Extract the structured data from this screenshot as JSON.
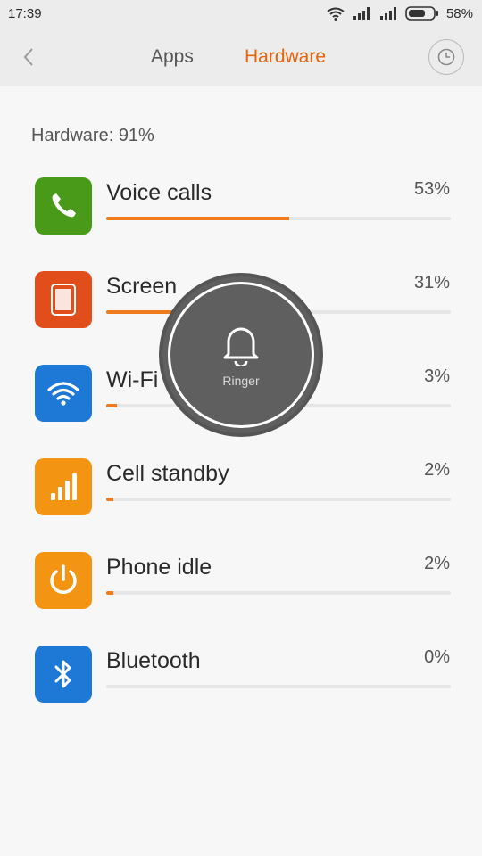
{
  "status_bar": {
    "time": "17:39",
    "battery": "58%"
  },
  "header": {
    "tabs": [
      {
        "label": "Apps"
      },
      {
        "label": "Hardware"
      }
    ]
  },
  "section_title": "Hardware: 91%",
  "colors": {
    "accent": "#e8630a",
    "bar_fill": "#f07b1c",
    "bar_track": "#e6e6e6"
  },
  "items": [
    {
      "label": "Voice calls",
      "percent": "53%",
      "value": 53,
      "icon": "phone-icon",
      "color": "#4a9a1a"
    },
    {
      "label": "Screen",
      "percent": "31%",
      "value": 31,
      "icon": "screen-icon",
      "color": "#e24e1b"
    },
    {
      "label": "Wi-Fi",
      "percent": "3%",
      "value": 3,
      "icon": "wifi-icon",
      "color": "#1e78d6"
    },
    {
      "label": "Cell standby",
      "percent": "2%",
      "value": 2,
      "icon": "signal-icon",
      "color": "#f39412"
    },
    {
      "label": "Phone idle",
      "percent": "2%",
      "value": 2,
      "icon": "power-icon",
      "color": "#f39412"
    },
    {
      "label": "Bluetooth",
      "percent": "0%",
      "value": 0,
      "icon": "bluetooth-icon",
      "color": "#1e78d6"
    }
  ],
  "ringer_overlay": {
    "label": "Ringer",
    "icon": "bell-icon"
  }
}
